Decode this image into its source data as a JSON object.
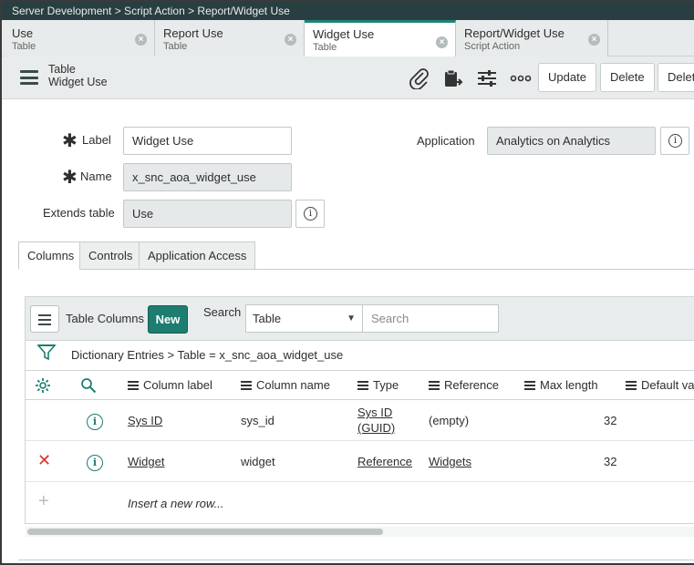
{
  "window": {
    "breadcrumb": "Server Development > Script Action > Report/Widget Use"
  },
  "tabs": [
    {
      "title": "Use",
      "subtitle": "Table"
    },
    {
      "title": "Report Use",
      "subtitle": "Table"
    },
    {
      "title": "Widget Use",
      "subtitle": "Table",
      "active": true
    },
    {
      "title": "Report/Widget Use",
      "subtitle": "Script Action"
    }
  ],
  "header": {
    "record_type": "Table",
    "record_name": "Widget Use",
    "buttons": {
      "update": "Update",
      "delete": "Delete",
      "delete_cut": "Delet"
    }
  },
  "form": {
    "label_label": "Label",
    "label_value": "Widget Use",
    "name_label": "Name",
    "name_value": "x_snc_aoa_widget_use",
    "extends_label": "Extends table",
    "extends_value": "Use",
    "application_label": "Application",
    "application_value": "Analytics on Analytics",
    "required_mark": "✱",
    "info_glyph": "i"
  },
  "related_tabs": [
    "Columns",
    "Controls",
    "Application Access"
  ],
  "list": {
    "title": "Table Columns",
    "new_label": "New",
    "search_label": "Search",
    "search_field": "Table",
    "search_placeholder": "Search",
    "breadcrumb": "Dictionary Entries  >  Table = x_snc_aoa_widget_use",
    "columns": [
      "Column label",
      "Column name",
      "Type",
      "Reference",
      "Max length",
      "Default val"
    ],
    "rows": [
      {
        "column_label": "Sys ID",
        "column_name": "sys_id",
        "type_line1": "Sys ID",
        "type_line2": "(GUID)",
        "reference": "(empty)",
        "max_length": "32"
      },
      {
        "column_label": "Widget",
        "column_name": "widget",
        "type": "Reference",
        "reference": "Widgets",
        "max_length": "32"
      }
    ],
    "insert_text": "Insert a new row...",
    "delete_glyph": "✕",
    "add_glyph": "+"
  },
  "colors": {
    "accent": "#1c7d70",
    "titlebar": "#293e40",
    "delete": "#d9342b"
  }
}
